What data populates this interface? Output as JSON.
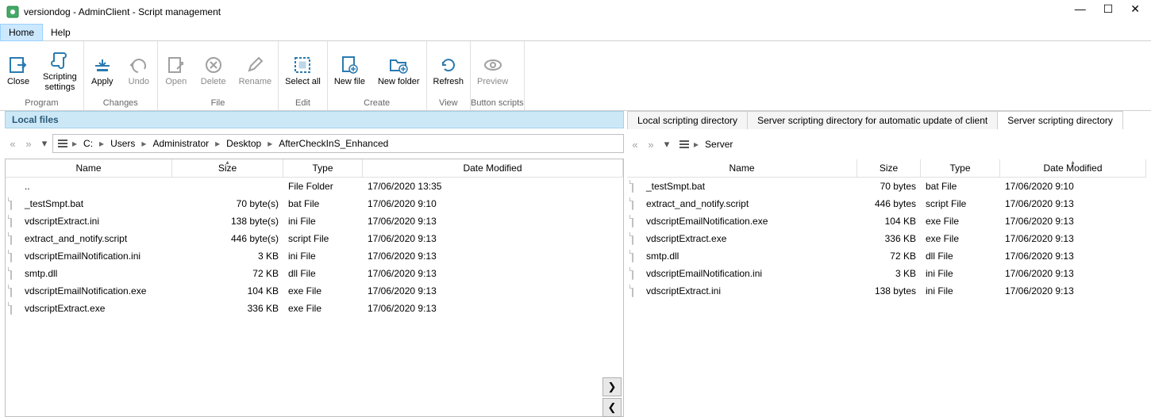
{
  "window": {
    "title": "versiondog - AdminClient - Script management"
  },
  "menu": {
    "home": "Home",
    "help": "Help"
  },
  "ribbon": {
    "groups": {
      "program": {
        "label": "Program",
        "close": "Close",
        "settings": "Scripting\nsettings"
      },
      "changes": {
        "label": "Changes",
        "apply": "Apply",
        "undo": "Undo"
      },
      "file": {
        "label": "File",
        "open": "Open",
        "delete": "Delete",
        "rename": "Rename"
      },
      "edit": {
        "label": "Edit",
        "selectall": "Select all"
      },
      "create": {
        "label": "Create",
        "newfile": "New file",
        "newfolder": "New folder"
      },
      "view": {
        "label": "View",
        "refresh": "Refresh"
      },
      "buttons": {
        "label": "Button scripts",
        "preview": "Preview"
      }
    }
  },
  "left": {
    "header": "Local files",
    "breadcrumb": [
      "C:",
      "Users",
      "Administrator",
      "Desktop",
      "AfterCheckInS_Enhanced"
    ],
    "columns": {
      "name": "Name",
      "size": "Size",
      "type": "Type",
      "date": "Date Modified"
    },
    "rows": [
      {
        "name": "..",
        "size": "",
        "type": "File Folder",
        "date": "17/06/2020 13:35"
      },
      {
        "name": "_testSmpt.bat",
        "size": "70 byte(s)",
        "type": "bat File",
        "date": "17/06/2020 9:10"
      },
      {
        "name": "vdscriptExtract.ini",
        "size": "138 byte(s)",
        "type": "ini File",
        "date": "17/06/2020 9:13"
      },
      {
        "name": "extract_and_notify.script",
        "size": "446 byte(s)",
        "type": "script File",
        "date": "17/06/2020 9:13"
      },
      {
        "name": "vdscriptEmailNotification.ini",
        "size": "3 KB",
        "type": "ini File",
        "date": "17/06/2020 9:13"
      },
      {
        "name": "smtp.dll",
        "size": "72 KB",
        "type": "dll File",
        "date": "17/06/2020 9:13"
      },
      {
        "name": "vdscriptEmailNotification.exe",
        "size": "104 KB",
        "type": "exe File",
        "date": "17/06/2020 9:13"
      },
      {
        "name": "vdscriptExtract.exe",
        "size": "336 KB",
        "type": "exe File",
        "date": "17/06/2020 9:13"
      }
    ]
  },
  "right": {
    "tabs": [
      "Local scripting directory",
      "Server scripting directory for automatic update of client",
      "Server scripting directory"
    ],
    "activeTab": 2,
    "breadcrumb": [
      "Server"
    ],
    "columns": {
      "name": "Name",
      "size": "Size",
      "type": "Type",
      "date": "Date Modified"
    },
    "rows": [
      {
        "name": "_testSmpt.bat",
        "size": "70 bytes",
        "type": "bat File",
        "date": "17/06/2020 9:10"
      },
      {
        "name": "extract_and_notify.script",
        "size": "446 bytes",
        "type": "script File",
        "date": "17/06/2020 9:13"
      },
      {
        "name": "vdscriptEmailNotification.exe",
        "size": "104 KB",
        "type": "exe File",
        "date": "17/06/2020 9:13"
      },
      {
        "name": "vdscriptExtract.exe",
        "size": "336 KB",
        "type": "exe File",
        "date": "17/06/2020 9:13"
      },
      {
        "name": "smtp.dll",
        "size": "72 KB",
        "type": "dll File",
        "date": "17/06/2020 9:13"
      },
      {
        "name": "vdscriptEmailNotification.ini",
        "size": "3 KB",
        "type": "ini File",
        "date": "17/06/2020 9:13"
      },
      {
        "name": "vdscriptExtract.ini",
        "size": "138 bytes",
        "type": "ini File",
        "date": "17/06/2020 9:13"
      }
    ]
  }
}
